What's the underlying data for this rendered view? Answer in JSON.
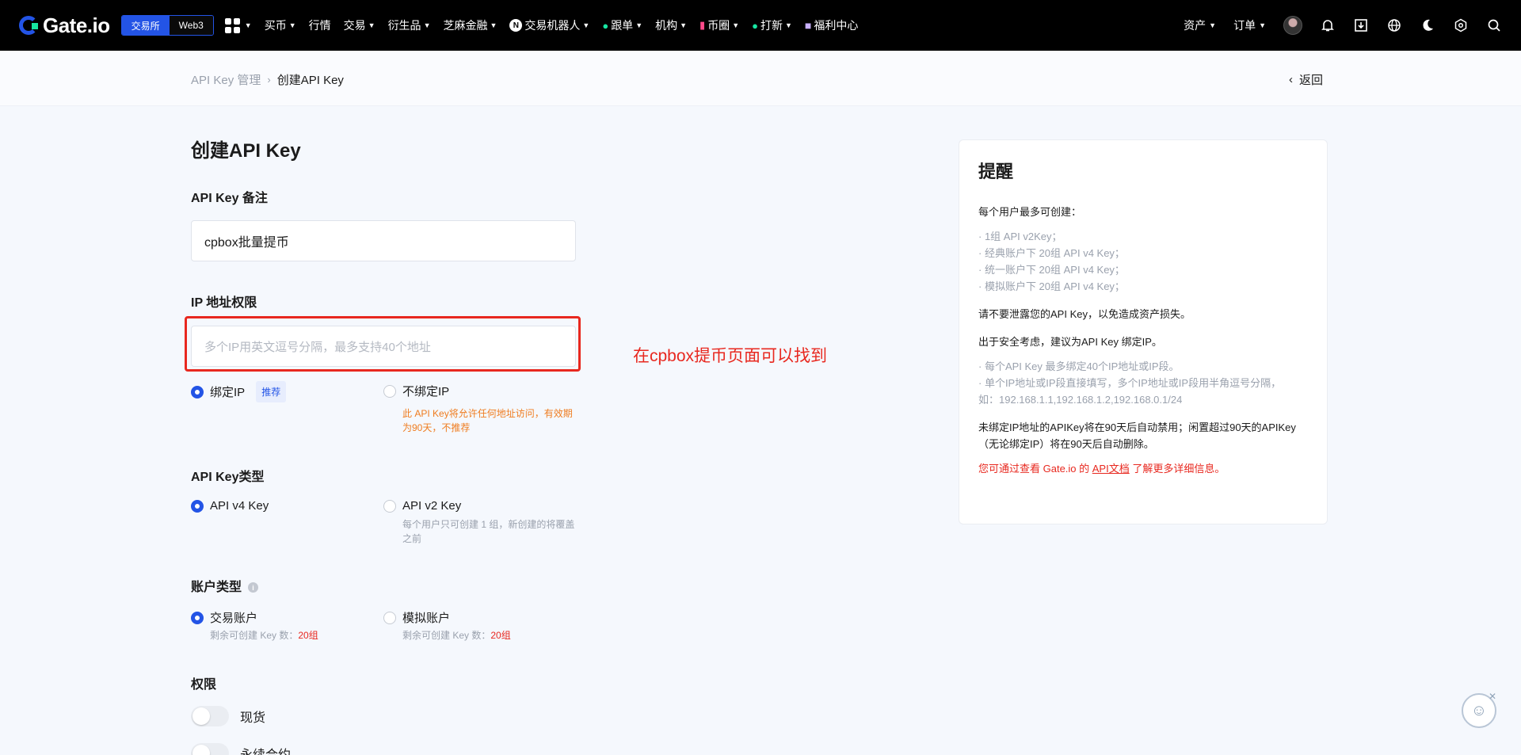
{
  "nav": {
    "logo": "Gate.io",
    "mode_exchange": "交易所",
    "mode_web3": "Web3",
    "items": [
      "买币",
      "行情",
      "交易",
      "衍生品",
      "芝麻金融",
      "交易机器人",
      "跟单",
      "机构",
      "币圈",
      "打新",
      "福利中心"
    ],
    "right_assets": "资产",
    "right_orders": "订单",
    "n_badge": "N"
  },
  "breadcrumb": {
    "prev": "API Key 管理",
    "sep": "›",
    "current": "创建API Key",
    "back": "返回",
    "back_icon": "‹"
  },
  "form": {
    "title": "创建API Key",
    "remark_label": "API Key 备注",
    "remark_value": "cpbox批量提币",
    "ip_label": "IP 地址权限",
    "ip_placeholder": "多个IP用英文逗号分隔，最多支持40个地址",
    "bind_ip": "绑定IP",
    "recommend_tag": "推荐",
    "no_bind_ip": "不绑定IP",
    "no_bind_hint": "此 API Key将允许任何地址访问，有效期为90天，不推荐",
    "type_label": "API Key类型",
    "v4": "API v4 Key",
    "v2": "API v2 Key",
    "v2_hint": "每个用户只可创建 1 组，新创建的将覆盖之前",
    "account_label": "账户类型",
    "info_icon": "i",
    "trade_account": "交易账户",
    "demo_account": "模拟账户",
    "remaining_prefix": "剩余可创建 Key 数：",
    "remaining_trade": "20组",
    "remaining_demo": "20组",
    "perm_label": "权限",
    "perm_spot": "现货",
    "perm_perp": "永续合约"
  },
  "annotation": "在cpbox提币页面可以找到",
  "reminder": {
    "title": "提醒",
    "intro": "每个用户最多可创建：",
    "limits": [
      "· 1组 API v2Key；",
      "· 经典账户下 20组 API v4 Key；",
      "· 统一账户下 20组 API v4 Key；",
      "· 模拟账户下 20组 API v4 Key；"
    ],
    "leak": "请不要泄露您的API Key，以免造成资产损失。",
    "security": "出于安全考虑，建议为API Key 绑定IP。",
    "ip_rules": [
      "· 每个API Key 最多绑定40个IP地址或IP段。",
      "· 单个IP地址或IP段直接填写，多个IP地址或IP段用半角逗号分隔，",
      "如：192.168.1.1,192.168.1.2,192.168.0.1/24"
    ],
    "unbound": "未绑定IP地址的APIKey将在90天后自动禁用；闲置超过90天的APIKey（无论绑定IP）将在90天后自动删除。",
    "doc_prefix": "您可通过查看 Gate.io 的 ",
    "doc_link": "API文档",
    "doc_suffix": " 了解更多详细信息。"
  },
  "colors": {
    "accent": "#2354e6",
    "annotation_red": "#e8281f",
    "warn_orange": "#ef7c1f"
  }
}
